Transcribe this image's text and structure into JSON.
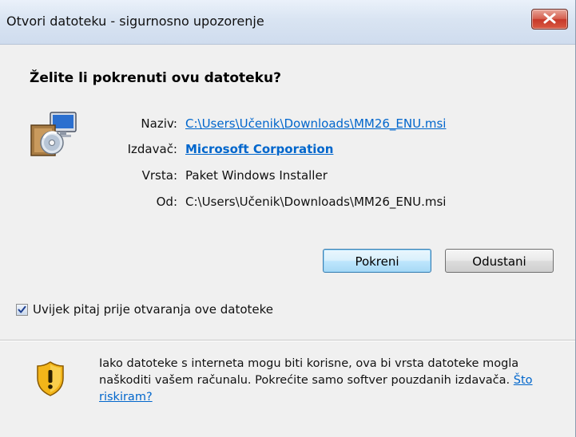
{
  "window": {
    "title": "Otvori datoteku - sigurnosno upozorenje",
    "close_symbol": "✕"
  },
  "dialog": {
    "heading": "Želite li pokrenuti ovu datoteku?",
    "fields": {
      "name_label": "Naziv:",
      "name_value": "C:\\Users\\Učenik\\Downloads\\MM26_ENU.msi",
      "publisher_label": "Izdavač:",
      "publisher_value": "Microsoft Corporation",
      "type_label": "Vrsta:",
      "type_value": "Paket Windows Installer",
      "from_label": "Od:",
      "from_value": "C:\\Users\\Učenik\\Downloads\\MM26_ENU.msi"
    },
    "buttons": {
      "run": "Pokreni",
      "cancel": "Odustani"
    },
    "checkbox": {
      "label": "Uvijek pitaj prije otvaranja ove datoteke",
      "checked": true
    },
    "warning": {
      "text": "Iako datoteke s interneta mogu biti korisne, ova bi vrsta datoteke mogla naškoditi vašem računalu. Pokrećite samo softver pouzdanih izdavača. ",
      "link": "Što riskiram?"
    }
  },
  "colors": {
    "link": "#0066cc",
    "title_bar": "#d9e4f2",
    "close_button": "#c7382a",
    "dialog_bg": "#f0f0f0"
  },
  "icons": {
    "app": "windows-installer-package-icon",
    "warning": "security-shield-warning-icon",
    "close": "close-icon"
  }
}
